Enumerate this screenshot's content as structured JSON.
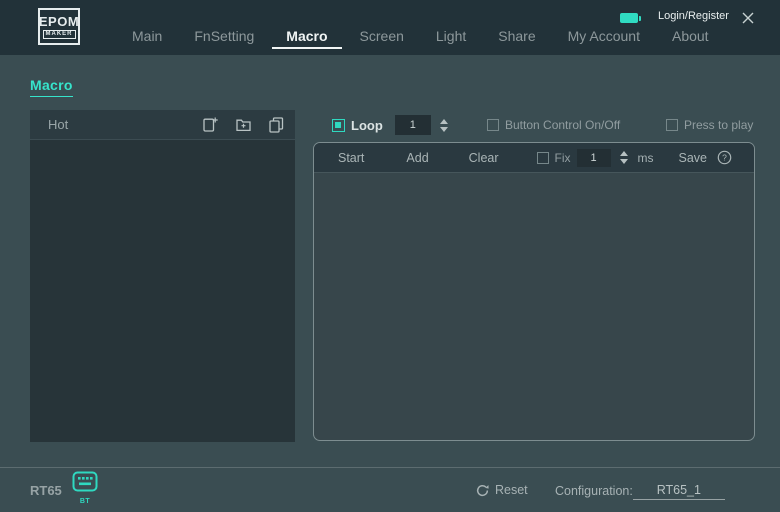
{
  "titlebar": {
    "logo": {
      "top": "EPOM",
      "bottom": "MAKER"
    },
    "nav": [
      {
        "label": "Main"
      },
      {
        "label": "FnSetting"
      },
      {
        "label": "Macro"
      },
      {
        "label": "Screen"
      },
      {
        "label": "Light"
      },
      {
        "label": "Share"
      },
      {
        "label": "My Account"
      },
      {
        "label": "About"
      }
    ],
    "active_tab": "Macro",
    "login_label": "Login/Register"
  },
  "page_title": "Macro",
  "macro_panel": {
    "header": "Hot",
    "icons": [
      "new-macro-icon",
      "add-folder-icon",
      "copy-macro-icon"
    ],
    "items": []
  },
  "loop_bar": {
    "loop_label": "Loop",
    "loop_checked": true,
    "loop_value": "1",
    "button_control_label": "Button Control On/Off",
    "button_control_checked": false,
    "press_to_play_label": "Press to play",
    "press_to_play_checked": false
  },
  "action_bar": {
    "start": "Start",
    "add": "Add",
    "clear": "Clear",
    "fix_label": "Fix",
    "fix_checked": false,
    "fix_value": "1",
    "unit": "ms",
    "save": "Save",
    "help": "?"
  },
  "status_bar": {
    "device": "RT65",
    "connection": "BT",
    "reset": "Reset",
    "config_label": "Configuration:",
    "config_value": "RT65_1"
  },
  "colors": {
    "accent_teal": "#2fd9c0",
    "titlebar_bg": "#223239",
    "main_bg": "#3a4d52",
    "panel_bg": "#273439",
    "panel_header_bg": "#2c3b41"
  }
}
